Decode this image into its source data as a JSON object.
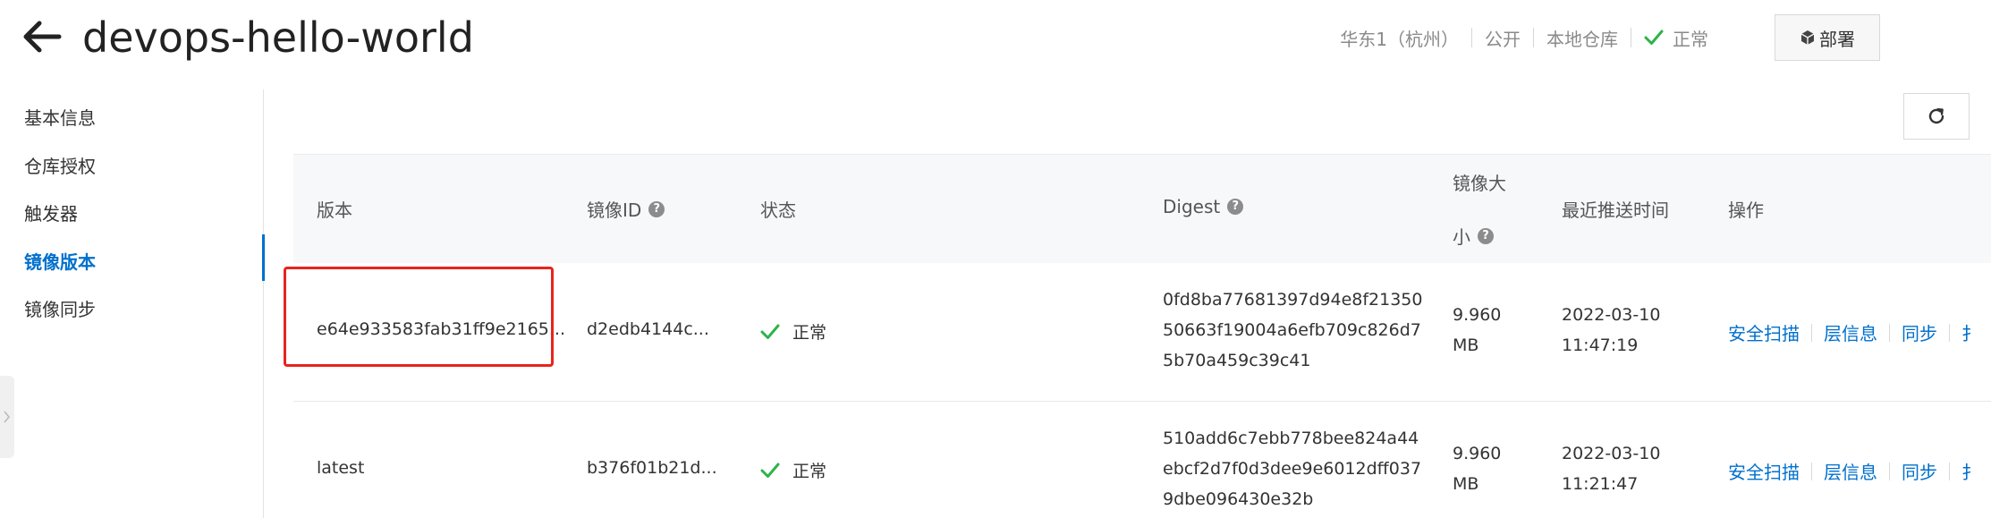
{
  "header": {
    "title": "devops-hello-world",
    "region": "华东1（杭州）",
    "visibility": "公开",
    "repo_type": "本地仓库",
    "status": "正常",
    "deploy_label": "部署"
  },
  "sidebar": {
    "items": [
      {
        "label": "基本信息"
      },
      {
        "label": "仓库授权"
      },
      {
        "label": "触发器"
      },
      {
        "label": "镜像版本"
      },
      {
        "label": "镜像同步"
      }
    ],
    "active_index": 3
  },
  "table": {
    "columns": {
      "version": "版本",
      "image_id": "镜像ID",
      "status": "状态",
      "digest": "Digest",
      "size_line1": "镜像大",
      "size_line2": "小",
      "pushed": "最近推送时间",
      "actions": "操作"
    },
    "help_glyph": "?",
    "rows": [
      {
        "version": "e64e933583fab31ff9e2165...",
        "image_id": "d2edb4144c...",
        "status": "正常",
        "digest_lines": [
          "0fd8ba77681397d94e8f21350",
          "50663f19004a6efb709c826d7",
          "5b70a459c39c41"
        ],
        "size_lines": [
          "9.960",
          "MB"
        ],
        "pushed_lines": [
          "2022-03-10",
          "11:47:19"
        ],
        "actions": [
          "安全扫描",
          "层信息",
          "同步",
          "扌"
        ]
      },
      {
        "version": "latest",
        "image_id": "b376f01b21d...",
        "status": "正常",
        "digest_lines": [
          "510add6c7ebb778bee824a44",
          "ebcf2d7f0d3dee9e6012dff037",
          "9dbe096430e32b"
        ],
        "size_lines": [
          "9.960",
          "MB"
        ],
        "pushed_lines": [
          "2022-03-10",
          "11:21:47"
        ],
        "actions": [
          "安全扫描",
          "层信息",
          "同步",
          "扌"
        ]
      }
    ]
  },
  "colors": {
    "accent": "#0070cc",
    "success": "#2db34a",
    "highlight": "#e8241c"
  },
  "icons": {
    "back": "arrow-left-icon",
    "status_ok": "check-icon",
    "deploy": "cube-icon",
    "refresh": "refresh-icon",
    "help": "question-circle-icon"
  }
}
